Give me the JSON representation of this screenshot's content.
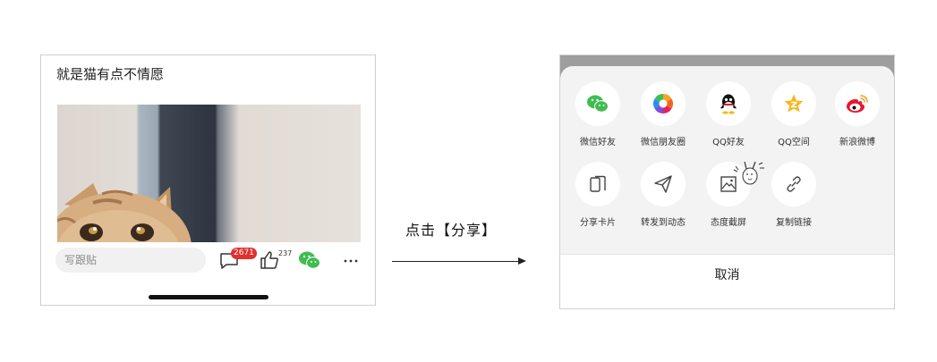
{
  "left_screen": {
    "post_title": "就是猫有点不情愿",
    "bottom_bar": {
      "reply_placeholder": "写跟贴",
      "comment_count": "2671",
      "like_count": "237"
    },
    "icons": [
      "comment-icon",
      "thumbs-up-icon",
      "wechat-icon",
      "more-icon"
    ]
  },
  "arrow_caption": "点击【分享】",
  "right_screen": {
    "share_row_1": [
      {
        "label": "微信好友",
        "icon": "wechat-icon",
        "color": "#3fbd4f"
      },
      {
        "label": "微信朋友圈",
        "icon": "moments-icon",
        "color": "#f0a020"
      },
      {
        "label": "QQ好友",
        "icon": "qq-icon",
        "color": "#111111"
      },
      {
        "label": "QQ空间",
        "icon": "qzone-icon",
        "color": "#f6b81c"
      },
      {
        "label": "新浪微博",
        "icon": "weibo-icon",
        "color": "#e6162d"
      }
    ],
    "share_row_2": [
      {
        "label": "分享卡片",
        "icon": "card-icon"
      },
      {
        "label": "转发到动态",
        "icon": "send-icon"
      },
      {
        "label": "态度截屏",
        "icon": "screenshot-icon"
      },
      {
        "label": "复制链接",
        "icon": "link-icon"
      }
    ],
    "cancel_label": "取消"
  }
}
